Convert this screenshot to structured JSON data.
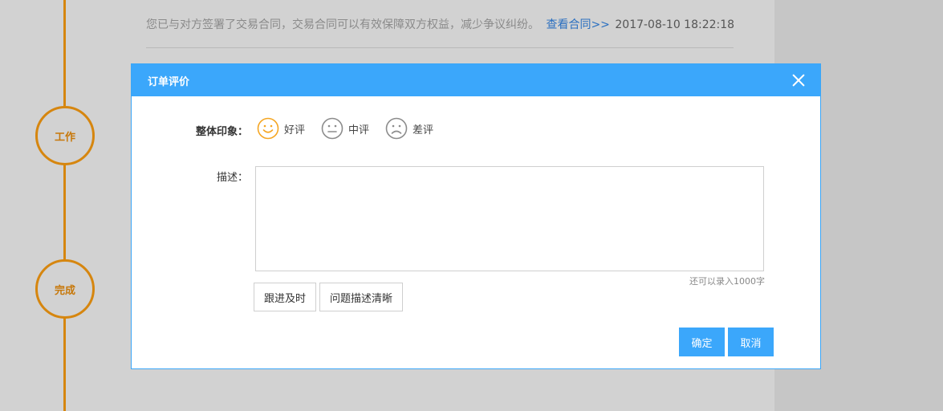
{
  "background": {
    "timeline": {
      "nodes": [
        {
          "label": "工作"
        },
        {
          "label": "完成"
        }
      ]
    },
    "activity": {
      "text": "您已与对方签署了交易合同，交易合同可以有效保障双方权益，减少争议纠纷。",
      "link": "查看合同>>",
      "time": "2017-08-10 18:22:18"
    }
  },
  "modal": {
    "title": "订单评价",
    "impression_label": "整体印象：",
    "ratings": [
      {
        "label": "好评",
        "icon": "smile-icon",
        "color": "#f5a623",
        "selected": true
      },
      {
        "label": "中评",
        "icon": "neutral-face-icon",
        "color": "#8c8c8c",
        "selected": false
      },
      {
        "label": "差评",
        "icon": "sad-face-icon",
        "color": "#8c8c8c",
        "selected": false
      }
    ],
    "description_label": "描述：",
    "description_value": "",
    "char_count": "还可以录入1000字",
    "tags": [
      {
        "label": "跟进及时"
      },
      {
        "label": "问题描述清晰"
      }
    ],
    "confirm_label": "确定",
    "cancel_label": "取消"
  },
  "colors": {
    "accent": "#3ba7fb",
    "timeline": "#d6860f"
  }
}
